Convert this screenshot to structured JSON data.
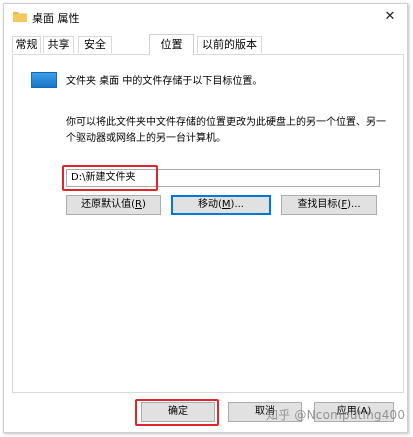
{
  "window": {
    "title": "桌面 属性",
    "close_glyph": "✕"
  },
  "tabs": [
    {
      "label": "常规",
      "active": false
    },
    {
      "label": "共享",
      "active": false
    },
    {
      "label": "安全",
      "active": false
    },
    {
      "label": "位置",
      "active": true
    },
    {
      "label": "以前的版本",
      "active": false
    }
  ],
  "location": {
    "description": "文件夹 桌面 中的文件存储于以下目标位置。",
    "instructions": "你可以将此文件夹中文件存储的位置更改为此硬盘上的另一个位置、另一个驱动器或网络上的另一台计算机。",
    "path_value": "D:\\新建文件夹"
  },
  "buttons": {
    "restore_default": {
      "label": "还原默认值(",
      "key": "R",
      "suffix": ")"
    },
    "move": {
      "label": "移动(",
      "key": "M",
      "suffix": ")..."
    },
    "find_target": {
      "label": "查找目标(",
      "key": "F",
      "suffix": ")..."
    }
  },
  "dialog_buttons": {
    "ok": "确定",
    "cancel": "取消",
    "apply": "应用(A)"
  },
  "watermark": "知乎 @Ncomputing400",
  "colors": {
    "highlight": "#e0262a",
    "focus": "#0078d7",
    "folder_icon": "#1a73c7"
  }
}
